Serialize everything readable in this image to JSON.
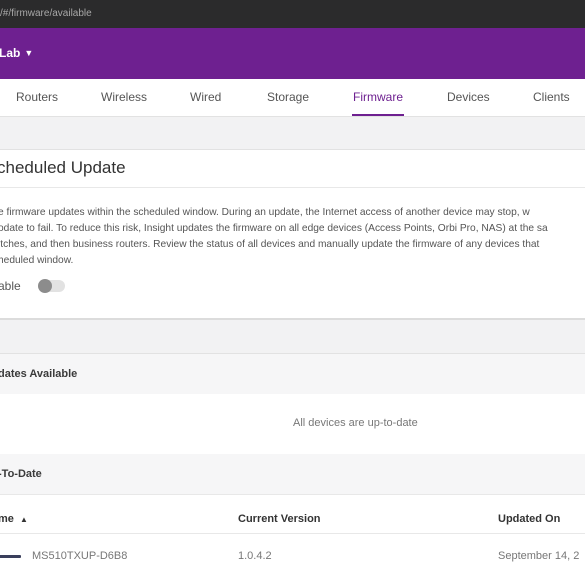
{
  "browser": {
    "url": "/#/firmware/available"
  },
  "header": {
    "org_name": "Lab"
  },
  "tabs": [
    {
      "label": "Routers"
    },
    {
      "label": "Wireless"
    },
    {
      "label": "Wired"
    },
    {
      "label": "Storage"
    },
    {
      "label": "Firmware",
      "active": true
    },
    {
      "label": "Devices"
    },
    {
      "label": "Clients"
    }
  ],
  "scheduled_update": {
    "title": "cheduled Update",
    "description_lines": [
      "e firmware updates within the scheduled window. During an update, the Internet access of another device may stop, w",
      "odate to fail. To reduce this risk, Insight updates the firmware on all edge devices (Access Points, Orbi Pro, NAS) at the sa",
      "itches, and then business routers. Review the status of all devices and manually update the firmware of any devices that",
      "heduled window."
    ],
    "enable_label": "able",
    "enabled": false
  },
  "updates_available": {
    "title": "dates Available",
    "empty_message": "All devices are up-to-date"
  },
  "up_to_date": {
    "title": "-To-Date",
    "columns": {
      "name": "me",
      "sort_icon": "▲",
      "current_version": "Current Version",
      "updated_on": "Updated On"
    },
    "rows": [
      {
        "name": "MS510TXUP-D6B8",
        "current_version": "1.0.4.2",
        "updated_on": "September 14, 2"
      }
    ]
  },
  "colors": {
    "brand": "#6e2090",
    "url_bar": "#2b2b2c"
  }
}
